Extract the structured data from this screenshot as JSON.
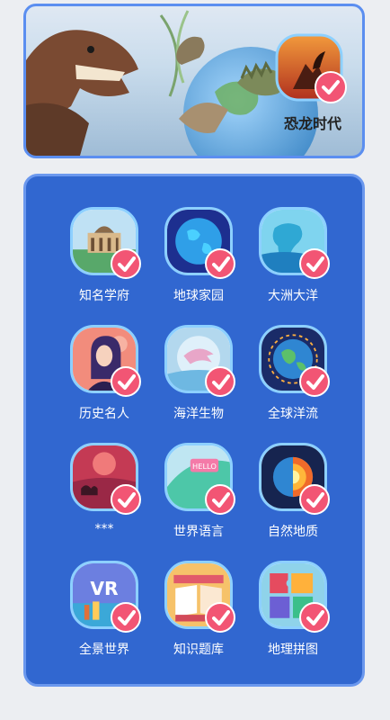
{
  "banner": {
    "title": "恐龙时代",
    "colors": {
      "border": "#5b8ef0",
      "badge_bg": "#c0492a"
    }
  },
  "grid": {
    "items": [
      {
        "label": "知名学府",
        "icon": "university-building-icon"
      },
      {
        "label": "地球家园",
        "icon": "earth-globe-icon"
      },
      {
        "label": "大洲大洋",
        "icon": "continent-map-icon"
      },
      {
        "label": "历史名人",
        "icon": "historical-figure-icon"
      },
      {
        "label": "海洋生物",
        "icon": "dolphin-icon"
      },
      {
        "label": "全球洋流",
        "icon": "ocean-current-globe-icon"
      },
      {
        "label": "***",
        "icon": "desert-camel-icon"
      },
      {
        "label": "世界语言",
        "icon": "hello-speech-icon"
      },
      {
        "label": "自然地质",
        "icon": "earth-layers-icon"
      },
      {
        "label": "全景世界",
        "icon": "vr-panorama-icon"
      },
      {
        "label": "知识题库",
        "icon": "book-library-icon"
      },
      {
        "label": "地理拼图",
        "icon": "puzzle-pieces-icon"
      }
    ]
  },
  "colors": {
    "panel": "#3167d0",
    "check": "#f25574",
    "tile_border": "#8dd0ff"
  }
}
